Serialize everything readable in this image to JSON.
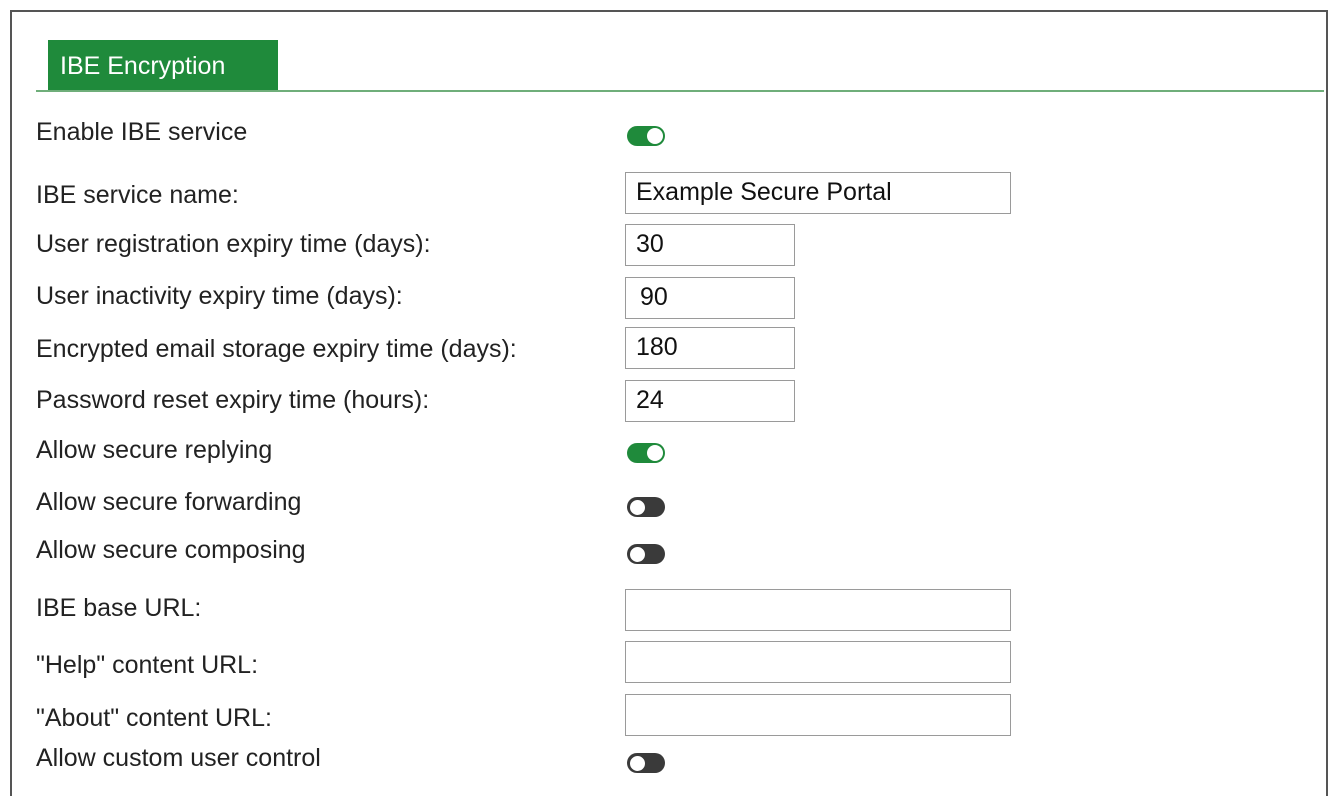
{
  "tab": {
    "label": "IBE Encryption",
    "accent_color": "#1f8a3b"
  },
  "fields": {
    "enable_ibe_service": {
      "label": "Enable IBE service",
      "state": "on"
    },
    "ibe_service_name": {
      "label": "IBE service name:",
      "value": "Example Secure Portal"
    },
    "user_registration_expiry": {
      "label": "User registration expiry time (days):",
      "value": "30"
    },
    "user_inactivity_expiry": {
      "label": "User inactivity expiry time (days):",
      "value": "90"
    },
    "encrypted_email_storage_expiry": {
      "label": "Encrypted email storage expiry time (days):",
      "value": "180"
    },
    "password_reset_expiry": {
      "label": "Password reset expiry time (hours):",
      "value": "24"
    },
    "allow_secure_replying": {
      "label": "Allow secure replying",
      "state": "on"
    },
    "allow_secure_forwarding": {
      "label": "Allow secure forwarding",
      "state": "off"
    },
    "allow_secure_composing": {
      "label": "Allow secure composing",
      "state": "off"
    },
    "ibe_base_url": {
      "label": "IBE base URL:",
      "value": ""
    },
    "help_content_url": {
      "label": "\"Help\" content URL:",
      "value": ""
    },
    "about_content_url": {
      "label": "\"About\" content URL:",
      "value": ""
    },
    "allow_custom_user_control": {
      "label": "Allow custom user control",
      "state": "off"
    }
  }
}
